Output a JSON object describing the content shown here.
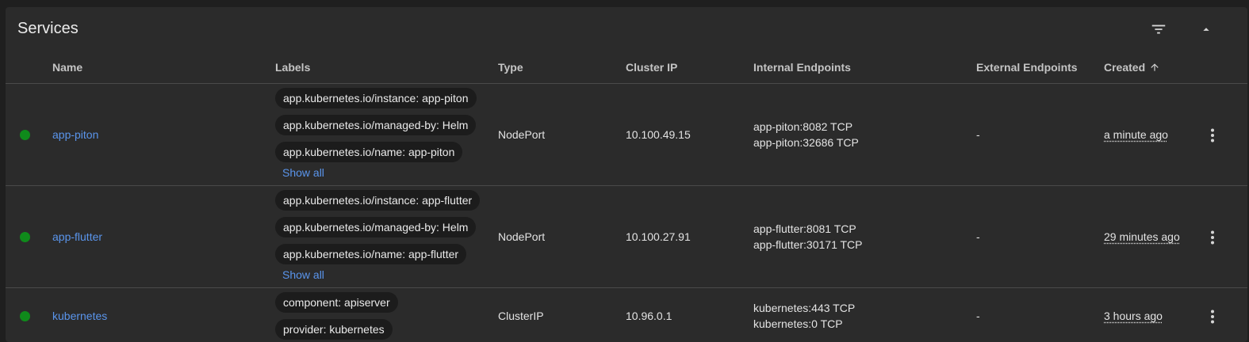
{
  "card": {
    "title": "Services",
    "filter_icon": "filter-list-icon",
    "collapse_icon": "arrow-drop-up-icon"
  },
  "columns": {
    "name": "Name",
    "labels": "Labels",
    "type": "Type",
    "cluster_ip": "Cluster IP",
    "internal_endpoints": "Internal Endpoints",
    "external_endpoints": "External Endpoints",
    "created": "Created",
    "created_sort_icon": "arrow-upward-icon"
  },
  "colors": {
    "status_ok": "#0f8a1b",
    "link": "#5a95ec",
    "card_bg": "#2b2b2b",
    "chip_bg": "#1c1c1c"
  },
  "rows": [
    {
      "status": "running",
      "name": "app-piton",
      "labels": [
        "app.kubernetes.io/instance: app-piton",
        "app.kubernetes.io/managed-by: Helm",
        "app.kubernetes.io/name: app-piton"
      ],
      "show_all": "Show all",
      "type": "NodePort",
      "cluster_ip": "10.100.49.15",
      "internal_endpoints": [
        "app-piton:8082 TCP",
        "app-piton:32686 TCP"
      ],
      "external_endpoints": "-",
      "created": "a minute ago"
    },
    {
      "status": "running",
      "name": "app-flutter",
      "labels": [
        "app.kubernetes.io/instance: app-flutter",
        "app.kubernetes.io/managed-by: Helm",
        "app.kubernetes.io/name: app-flutter"
      ],
      "show_all": "Show all",
      "type": "NodePort",
      "cluster_ip": "10.100.27.91",
      "internal_endpoints": [
        "app-flutter:8081 TCP",
        "app-flutter:30171 TCP"
      ],
      "external_endpoints": "-",
      "created": "29 minutes ago"
    },
    {
      "status": "running",
      "name": "kubernetes",
      "labels": [
        "component: apiserver",
        "provider: kubernetes"
      ],
      "type": "ClusterIP",
      "cluster_ip": "10.96.0.1",
      "internal_endpoints": [
        "kubernetes:443 TCP",
        "kubernetes:0 TCP"
      ],
      "external_endpoints": "-",
      "created": "3 hours ago"
    }
  ]
}
